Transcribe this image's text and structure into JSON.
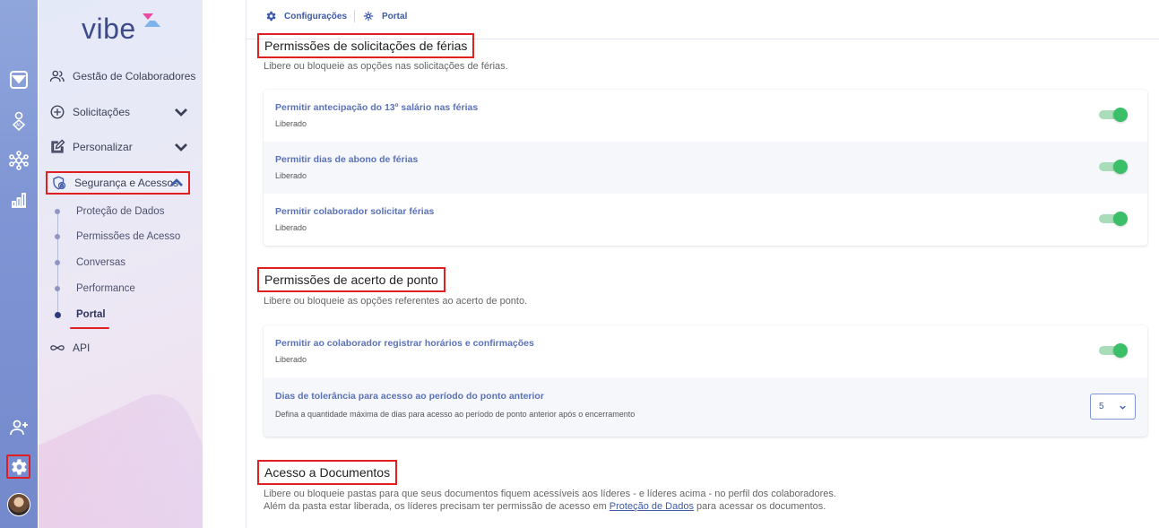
{
  "brand": {
    "logo_text": "vibe"
  },
  "rail": {
    "icons": [
      "inbox-icon",
      "ai-user-icon",
      "network-icon",
      "bar-chart-icon",
      "add-user-icon",
      "settings-icon",
      "avatar"
    ]
  },
  "sidebar": {
    "items": [
      {
        "label": "Gestão de Colaboradores",
        "icon": "users-icon"
      },
      {
        "label": "Solicitações",
        "icon": "plus-circle-icon"
      },
      {
        "label": "Personalizar",
        "icon": "edit-icon"
      },
      {
        "label": "Segurança e Acessos",
        "icon": "shield-lock-icon"
      },
      {
        "label": "API",
        "icon": "infinity-icon"
      }
    ],
    "subitems": [
      {
        "label": "Proteção de Dados"
      },
      {
        "label": "Permissões de Acesso"
      },
      {
        "label": "Conversas"
      },
      {
        "label": "Performance"
      },
      {
        "label": "Portal"
      }
    ]
  },
  "breadcrumb": {
    "items": [
      "Configurações",
      "Portal"
    ]
  },
  "sections": [
    {
      "title": "Permissões de solicitações de férias",
      "description": "Libere ou bloqueie as opções nas solicitações de férias.",
      "rows": [
        {
          "title": "Permitir antecipação do 13º salário nas férias",
          "status": "Liberado",
          "enabled": true
        },
        {
          "title": "Permitir dias de abono de férias",
          "status": "Liberado",
          "enabled": true
        },
        {
          "title": "Permitir colaborador solicitar férias",
          "status": "Liberado",
          "enabled": true
        }
      ]
    },
    {
      "title": "Permissões de acerto de ponto",
      "description": "Libere ou bloqueie as opções referentes ao acerto de ponto.",
      "rows": [
        {
          "title": "Permitir ao colaborador registrar horários e confirmações",
          "status": "Liberado",
          "enabled": true
        },
        {
          "title": "Dias de tolerância para acesso ao período do ponto anterior",
          "status": "Defina a quantidade máxima de dias para acesso ao período de ponto anterior após o encerramento",
          "select_value": "5"
        }
      ]
    },
    {
      "title": "Acesso a Documentos",
      "description_line1": "Libere ou bloqueie pastas para que seus documentos fiquem acessíveis aos líderes - e líderes acima - no perfil dos colaboradores.",
      "description_line2_before": "Além da pasta estar liberada, os líderes precisam ter permissão de acesso em ",
      "description_line2_link": "Proteção de Dados",
      "description_line2_after": " para acessar os documentos."
    }
  ],
  "colors": {
    "accent": "#3d5aa8",
    "toggle_on": "#3bbf68",
    "highlight": "#e02020"
  }
}
